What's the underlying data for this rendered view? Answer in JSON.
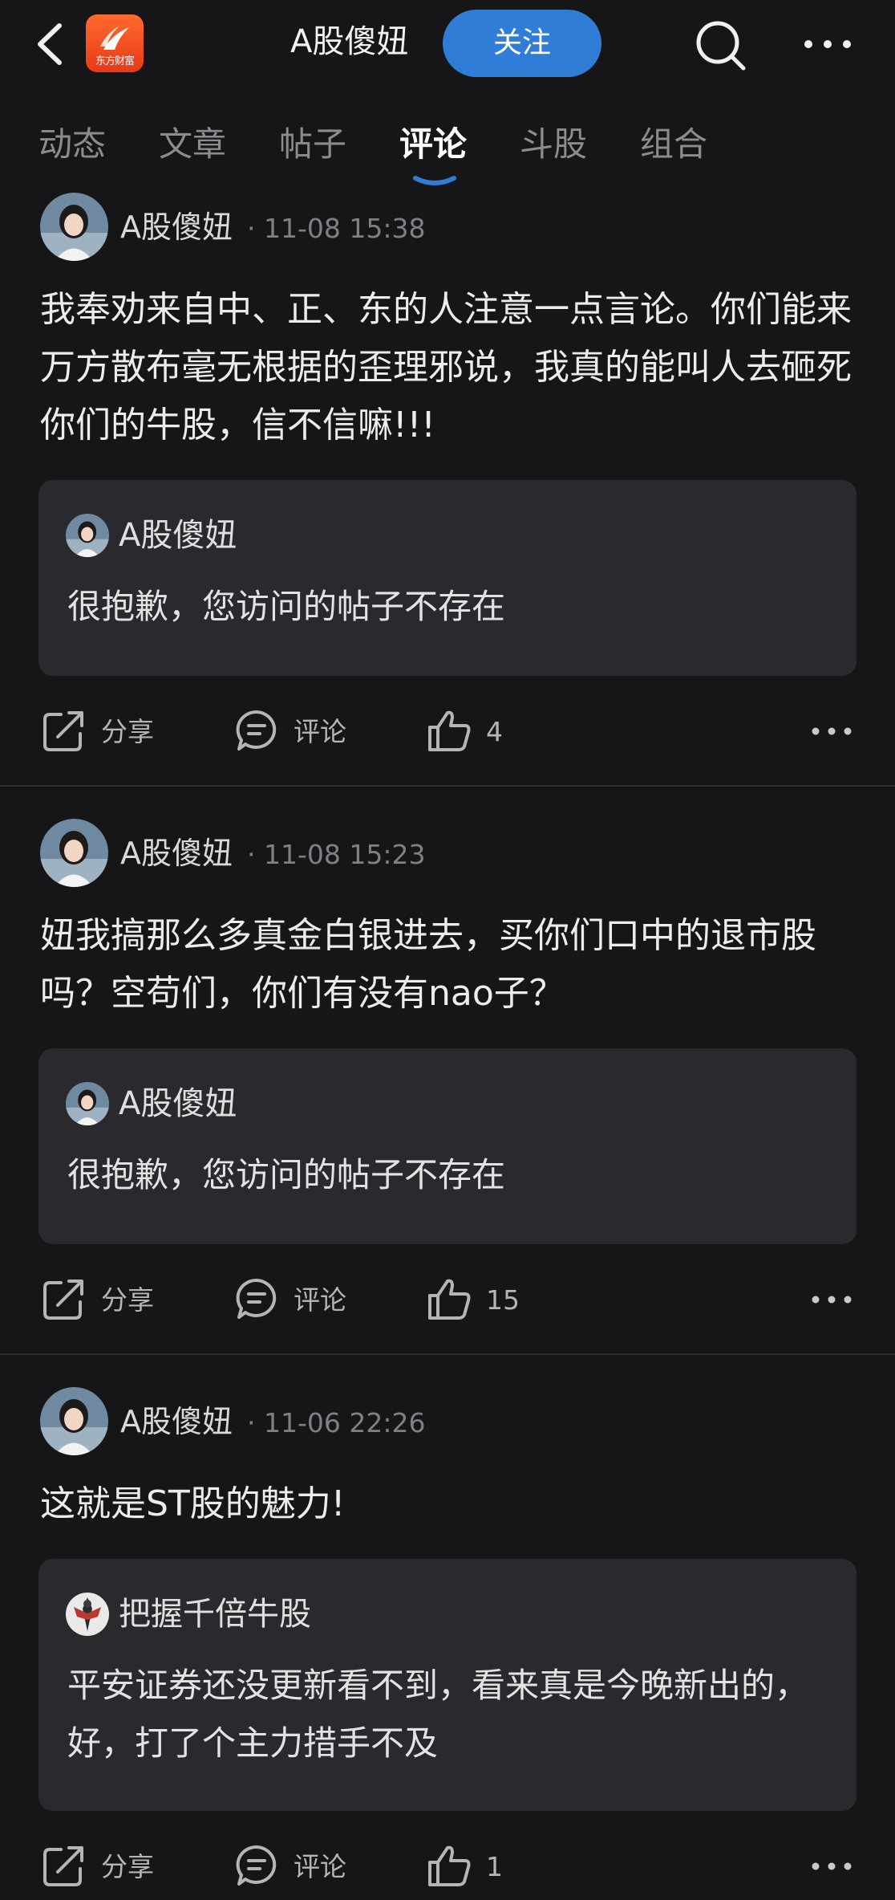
{
  "header": {
    "app_logo_text": "东方财富",
    "profile_name": "A股傻妞",
    "follow_label": "关注"
  },
  "tabs": [
    {
      "label": "动态",
      "active": false
    },
    {
      "label": "文章",
      "active": false
    },
    {
      "label": "帖子",
      "active": false
    },
    {
      "label": "评论",
      "active": true
    },
    {
      "label": "斗股",
      "active": false
    },
    {
      "label": "组合",
      "active": false
    }
  ],
  "posts": [
    {
      "author": "A股傻妞",
      "time": "· 11-08 15:38",
      "text": "我奉劝来自中、正、东的人注意一点言论。你们能来万方散布毫无根据的歪理邪说，我真的能叫人去砸死你们的牛股，信不信嘛!!!",
      "quote": {
        "author": "A股傻妞",
        "text": "很抱歉，您访问的帖子不存在"
      },
      "share": "分享",
      "comment": "评论",
      "likes": "4"
    },
    {
      "author": "A股傻妞",
      "time": "· 11-08 15:23",
      "text": "妞我搞那么多真金白银进去，买你们口中的退市股吗？空苟们，你们有没有nao子？",
      "quote": {
        "author": "A股傻妞",
        "text": "很抱歉，您访问的帖子不存在"
      },
      "share": "分享",
      "comment": "评论",
      "likes": "15"
    },
    {
      "author": "A股傻妞",
      "time": "· 11-06 22:26",
      "text": "这就是ST股的魅力!",
      "quote": {
        "author": "把握千倍牛股",
        "text": "平安证券还没更新看不到，看来真是今晚新出的，好，打了个主力措手不及"
      },
      "share": "分享",
      "comment": "评论",
      "likes": "1"
    }
  ],
  "colors": {
    "background": "#161618",
    "card": "#2a2a2e",
    "accent": "#2f7dd6"
  },
  "icons": [
    "back-icon",
    "search-icon",
    "more-icon",
    "share-icon",
    "comment-icon",
    "like-icon"
  ]
}
